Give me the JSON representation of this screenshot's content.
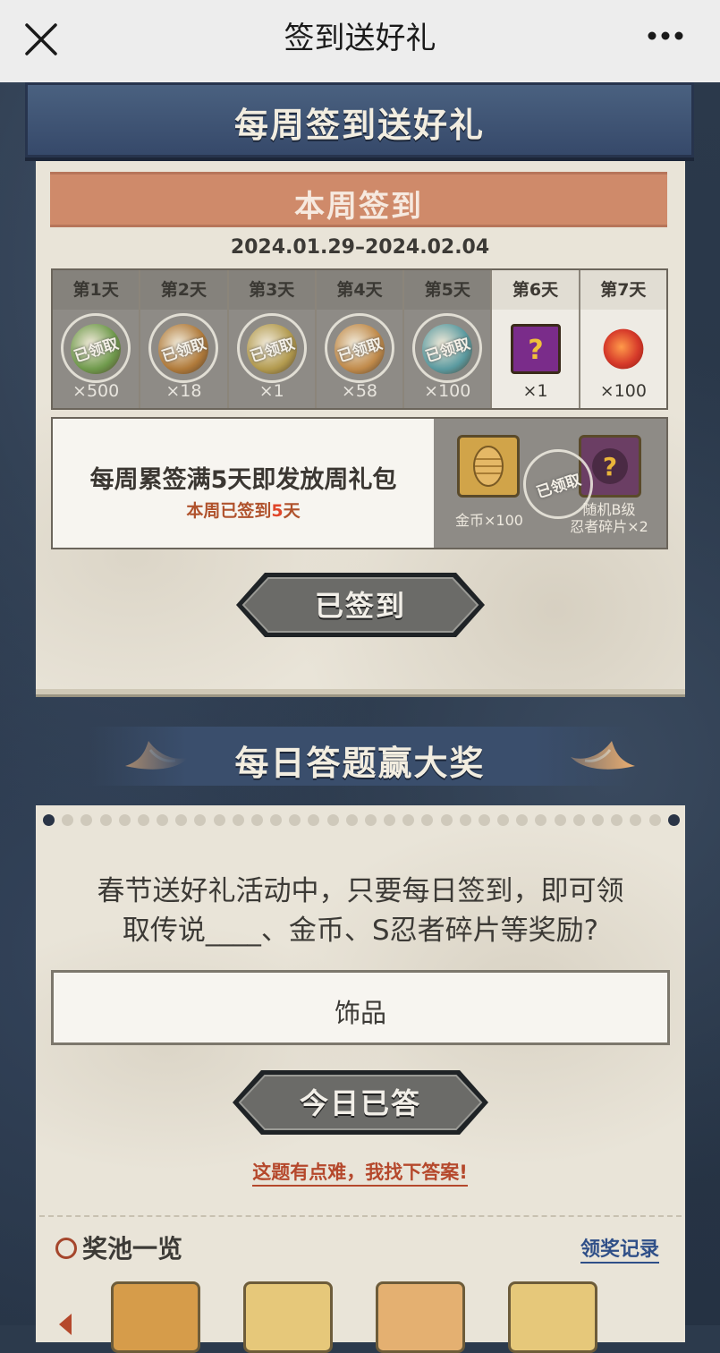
{
  "topbar": {
    "title": "签到送好礼"
  },
  "checkin": {
    "banner": "每周签到送好礼",
    "week_title": "本周签到",
    "date_range": "2024.01.29–2024.02.04",
    "stamp_text": "已领取",
    "days": [
      {
        "label": "第1天",
        "qty": "×500",
        "claimed": true,
        "color": "#6f9a4c"
      },
      {
        "label": "第2天",
        "qty": "×18",
        "claimed": true,
        "color": "#b07a3a"
      },
      {
        "label": "第3天",
        "qty": "×1",
        "claimed": true,
        "color": "#b29a4e"
      },
      {
        "label": "第4天",
        "qty": "×58",
        "claimed": true,
        "color": "#c08a4a"
      },
      {
        "label": "第5天",
        "qty": "×100",
        "claimed": true,
        "color": "#5a9aa0"
      },
      {
        "label": "第6天",
        "qty": "×1",
        "claimed": false,
        "color": "#7a2c8a"
      },
      {
        "label": "第7天",
        "qty": "×100",
        "claimed": false,
        "color": "#d63a2a"
      }
    ],
    "weekly_line1": "每周累签满5天即发放周礼包",
    "weekly_line2_prefix": "本周已签到",
    "weekly_line2_num": "5",
    "weekly_line2_suffix": "天",
    "gift1_label": "金币×100",
    "gift2_label_1": "随机B级",
    "gift2_label_2": "忍者碎片×2",
    "button": "已签到"
  },
  "quiz": {
    "banner": "每日答题赢大奖",
    "question_line1": "春节送好礼活动中，只要每日签到，即可领",
    "question_line2": "取传说____、金币、S忍者碎片等奖励?",
    "answer": "饰品",
    "button": "今日已答",
    "hint": "这题有点难，我找下答案!"
  },
  "pool": {
    "title": "奖池一览",
    "record_link": "领奖记录"
  },
  "colors": {
    "accent": "#cf8a6a",
    "hint": "#b5482c",
    "link": "#2f4f88"
  }
}
